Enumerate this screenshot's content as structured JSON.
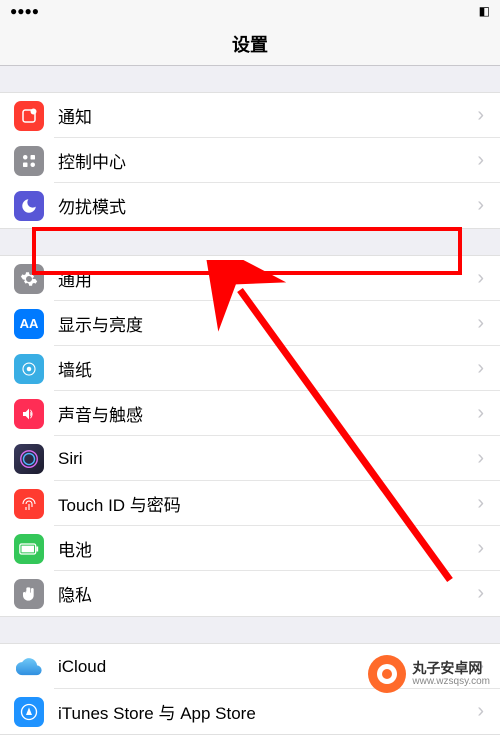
{
  "header": {
    "title": "设置"
  },
  "sections": [
    {
      "items": [
        {
          "key": "notifications",
          "label": "通知",
          "icon": "notifications-icon",
          "bg": "#ff3b30"
        },
        {
          "key": "control-center",
          "label": "控制中心",
          "icon": "control-center-icon",
          "bg": "#8e8e93"
        },
        {
          "key": "dnd",
          "label": "勿扰模式",
          "icon": "moon-icon",
          "bg": "#5856d6"
        }
      ]
    },
    {
      "items": [
        {
          "key": "general",
          "label": "通用",
          "icon": "gear-icon",
          "bg": "#8e8e93",
          "highlighted": true
        },
        {
          "key": "display",
          "label": "显示与亮度",
          "icon": "text-size-icon",
          "bg": "#007aff"
        },
        {
          "key": "wallpaper",
          "label": "墙纸",
          "icon": "wallpaper-icon",
          "bg": "#39aee4"
        },
        {
          "key": "sounds",
          "label": "声音与触感",
          "icon": "speaker-icon",
          "bg": "#ff2d55"
        },
        {
          "key": "siri",
          "label": "Siri",
          "icon": "siri-icon",
          "bg": "#1c1c1e"
        },
        {
          "key": "touchid",
          "label": "Touch ID 与密码",
          "icon": "fingerprint-icon",
          "bg": "#ff3b30"
        },
        {
          "key": "battery",
          "label": "电池",
          "icon": "battery-icon",
          "bg": "#34c759"
        },
        {
          "key": "privacy",
          "label": "隐私",
          "icon": "hand-icon",
          "bg": "#8e8e93"
        }
      ]
    },
    {
      "items": [
        {
          "key": "icloud",
          "label": "iCloud",
          "icon": "cloud-icon",
          "bg": "#ffffff"
        },
        {
          "key": "itunes",
          "label": "iTunes Store 与 App Store",
          "icon": "appstore-icon",
          "bg": "#1f93ff"
        }
      ]
    }
  ],
  "watermark": {
    "title": "丸子安卓网",
    "url": "www.wzsqsy.com"
  },
  "colors": {
    "highlight": "#ff0000",
    "arrow": "#ff0000"
  }
}
